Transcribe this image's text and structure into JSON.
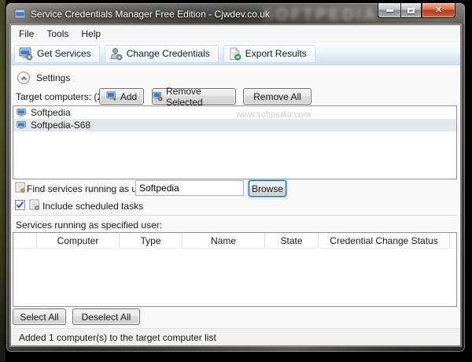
{
  "window": {
    "title": "Service Credentials Manager Free Edition - Cjwdev.co.uk",
    "background_watermark": "SOFTPEDIA"
  },
  "menu": {
    "items": [
      "File",
      "Tools",
      "Help"
    ]
  },
  "toolbar": {
    "buttons": [
      {
        "label": "Get Services",
        "icon": "computer-gear-icon"
      },
      {
        "label": "Change Credentials",
        "icon": "user-gear-icon"
      },
      {
        "label": "Export Results",
        "icon": "document-export-icon"
      }
    ]
  },
  "settings": {
    "header_label": "Settings",
    "target_computers_label": "Target computers: (2)",
    "add_button": "Add",
    "remove_selected_button": "Remove Selected",
    "remove_all_button": "Remove All",
    "computer_list": [
      {
        "name": "Softpedia",
        "selected": false
      },
      {
        "name": "Softpedia-S68",
        "selected": true
      }
    ],
    "list_watermark": "www.softpedia.com",
    "find_user_label": "Find services running as user:",
    "find_user_value": "Softpedia",
    "browse_button": "Browse",
    "include_tasks_label": "Include scheduled tasks",
    "include_tasks_checked": true
  },
  "services": {
    "section_label": "Services running as specified user:",
    "columns": [
      "",
      "Computer",
      "Type",
      "Name",
      "State",
      "Credential Change Status"
    ],
    "rows": [],
    "select_all_button": "Select All",
    "deselect_all_button": "Deselect All"
  },
  "statusbar": {
    "text": "Added 1 computer(s) to the target computer list"
  },
  "icons": {
    "minimize": "minimize-icon",
    "maximize": "maximize-icon",
    "close_glyph": "✕",
    "collapse": "chevron-up-icon",
    "computer": "computer-icon",
    "add_computer": "computer-plus-icon",
    "remove_computer": "computer-minus-icon",
    "find_user": "task-list-icon",
    "scheduled_tasks": "task-gear-icon"
  },
  "colors": {
    "close_button_red": "#c8502f",
    "selection_inactive": "#e4e8ec",
    "focus_ring_blue": "#5ab4e0",
    "monitor_screen_blue": "#2f7cd4",
    "toolbar_tint": "#d2e2ef"
  }
}
